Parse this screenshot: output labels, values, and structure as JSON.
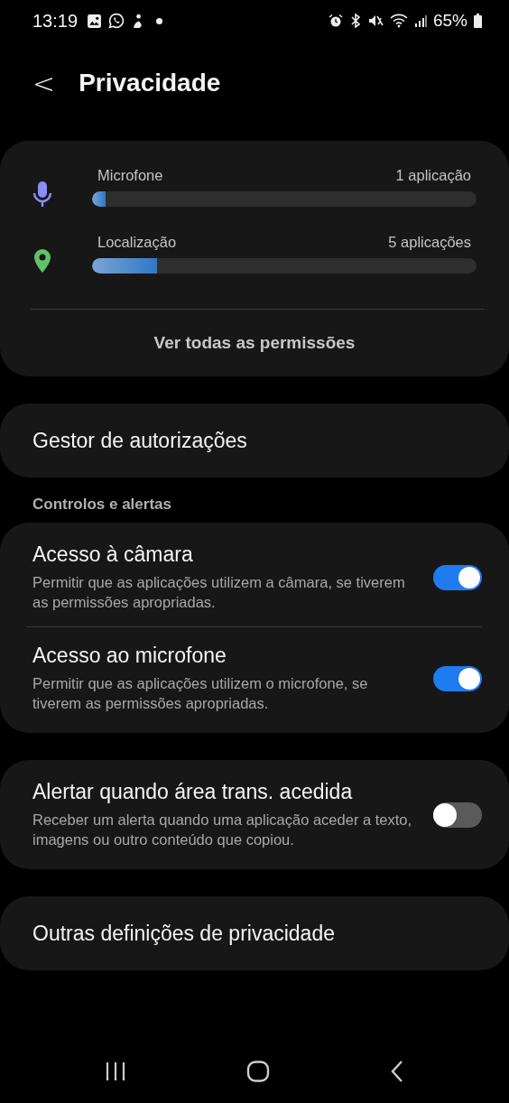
{
  "status_bar": {
    "time": "13:19",
    "battery": "65%"
  },
  "header": {
    "back": "<",
    "title": "Privacidade"
  },
  "usage_card": {
    "items": [
      {
        "kind": "microphone",
        "label": "Microfone",
        "count": "1 aplicação",
        "level": 0.035
      },
      {
        "kind": "location",
        "label": "Localização",
        "count": "5 aplicações",
        "level": 0.17
      }
    ],
    "link": "Ver todas as permissões"
  },
  "permission_manager": "Gestor de autorizações",
  "section_title": "Controlos e alertas",
  "toggle_groups": [
    [
      {
        "title": "Acesso à câmara",
        "description": "Permitir que as aplicações utilizem a câmara, se tiverem as permissões apropriadas.",
        "on": true
      },
      {
        "title": "Acesso ao microfone",
        "description": "Permitir que as aplicações utilizem o microfone, se tiverem as permissões apropriadas.",
        "on": true
      }
    ],
    [
      {
        "title": "Alertar quando área trans. acedida",
        "description": "Receber um alerta quando uma aplicação aceder a texto, imagens ou outro conteúdo que copiou.",
        "on": false
      }
    ]
  ],
  "other_settings": "Outras definições de privacidade"
}
